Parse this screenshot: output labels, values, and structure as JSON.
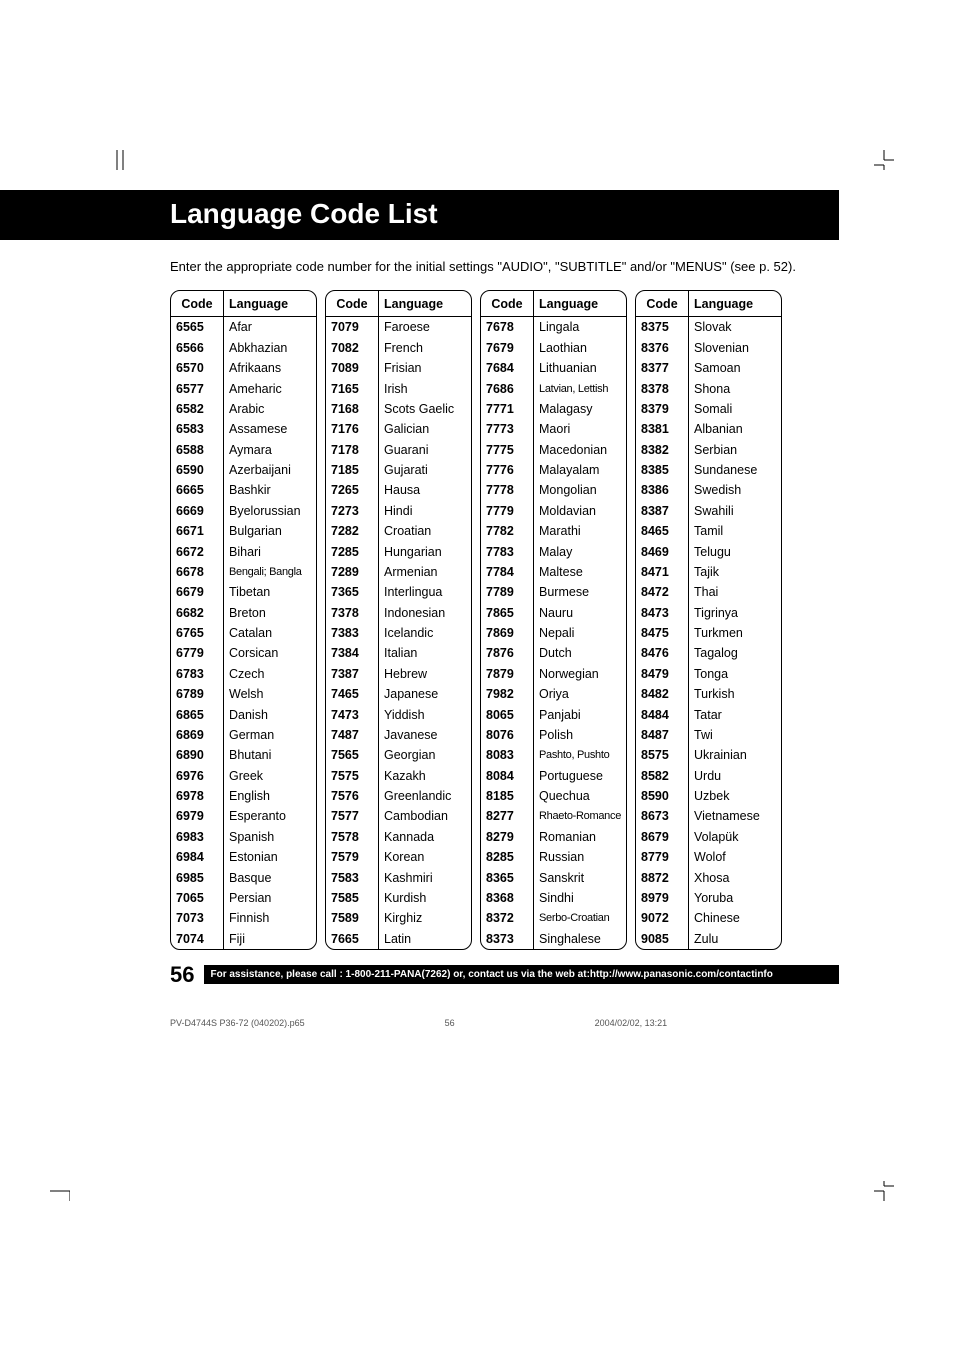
{
  "title": "Language Code List",
  "intro": "Enter the appropriate code number for the initial settings \"AUDIO\", \"SUBTITLE\" and/or \"MENUS\" (see p. 52).",
  "header_code": "Code",
  "header_language": "Language",
  "page_number": "56",
  "assist_text": "For assistance, please call : 1-800-211-PANA(7262) or, contact us via the web at:http://www.panasonic.com/contactinfo",
  "print_file": "PV-D4744S P36-72 (040202).p65",
  "print_page": "56",
  "print_date": "2004/02/02, 13:21",
  "columns": [
    [
      {
        "code": "6565",
        "lang": "Afar"
      },
      {
        "code": "6566",
        "lang": "Abkhazian"
      },
      {
        "code": "6570",
        "lang": "Afrikaans"
      },
      {
        "code": "6577",
        "lang": "Ameharic"
      },
      {
        "code": "6582",
        "lang": "Arabic"
      },
      {
        "code": "6583",
        "lang": "Assamese"
      },
      {
        "code": "6588",
        "lang": "Aymara"
      },
      {
        "code": "6590",
        "lang": "Azerbaijani"
      },
      {
        "code": "6665",
        "lang": "Bashkir"
      },
      {
        "code": "6669",
        "lang": "Byelorussian"
      },
      {
        "code": "6671",
        "lang": "Bulgarian"
      },
      {
        "code": "6672",
        "lang": "Bihari"
      },
      {
        "code": "6678",
        "lang": "Bengali; Bangla",
        "small": true
      },
      {
        "code": "6679",
        "lang": "Tibetan"
      },
      {
        "code": "6682",
        "lang": "Breton"
      },
      {
        "code": "6765",
        "lang": "Catalan"
      },
      {
        "code": "6779",
        "lang": "Corsican"
      },
      {
        "code": "6783",
        "lang": "Czech"
      },
      {
        "code": "6789",
        "lang": "Welsh"
      },
      {
        "code": "6865",
        "lang": "Danish"
      },
      {
        "code": "6869",
        "lang": "German"
      },
      {
        "code": "6890",
        "lang": "Bhutani"
      },
      {
        "code": "6976",
        "lang": "Greek"
      },
      {
        "code": "6978",
        "lang": "English"
      },
      {
        "code": "6979",
        "lang": "Esperanto"
      },
      {
        "code": "6983",
        "lang": "Spanish"
      },
      {
        "code": "6984",
        "lang": "Estonian"
      },
      {
        "code": "6985",
        "lang": "Basque"
      },
      {
        "code": "7065",
        "lang": "Persian"
      },
      {
        "code": "7073",
        "lang": "Finnish"
      },
      {
        "code": "7074",
        "lang": "Fiji"
      }
    ],
    [
      {
        "code": "7079",
        "lang": "Faroese"
      },
      {
        "code": "7082",
        "lang": "French"
      },
      {
        "code": "7089",
        "lang": "Frisian"
      },
      {
        "code": "7165",
        "lang": "Irish"
      },
      {
        "code": "7168",
        "lang": "Scots Gaelic"
      },
      {
        "code": "7176",
        "lang": "Galician"
      },
      {
        "code": "7178",
        "lang": "Guarani"
      },
      {
        "code": "7185",
        "lang": "Gujarati"
      },
      {
        "code": "7265",
        "lang": "Hausa"
      },
      {
        "code": "7273",
        "lang": "Hindi"
      },
      {
        "code": "7282",
        "lang": "Croatian"
      },
      {
        "code": "7285",
        "lang": "Hungarian"
      },
      {
        "code": "7289",
        "lang": "Armenian"
      },
      {
        "code": "7365",
        "lang": "Interlingua"
      },
      {
        "code": "7378",
        "lang": "Indonesian"
      },
      {
        "code": "7383",
        "lang": "Icelandic"
      },
      {
        "code": "7384",
        "lang": "Italian"
      },
      {
        "code": "7387",
        "lang": "Hebrew"
      },
      {
        "code": "7465",
        "lang": "Japanese"
      },
      {
        "code": "7473",
        "lang": "Yiddish"
      },
      {
        "code": "7487",
        "lang": "Javanese"
      },
      {
        "code": "7565",
        "lang": "Georgian"
      },
      {
        "code": "7575",
        "lang": "Kazakh"
      },
      {
        "code": "7576",
        "lang": "Greenlandic"
      },
      {
        "code": "7577",
        "lang": "Cambodian"
      },
      {
        "code": "7578",
        "lang": "Kannada"
      },
      {
        "code": "7579",
        "lang": "Korean"
      },
      {
        "code": "7583",
        "lang": "Kashmiri"
      },
      {
        "code": "7585",
        "lang": "Kurdish"
      },
      {
        "code": "7589",
        "lang": "Kirghiz"
      },
      {
        "code": "7665",
        "lang": "Latin"
      }
    ],
    [
      {
        "code": "7678",
        "lang": "Lingala"
      },
      {
        "code": "7679",
        "lang": "Laothian"
      },
      {
        "code": "7684",
        "lang": "Lithuanian"
      },
      {
        "code": "7686",
        "lang": "Latvian, Lettish",
        "small": true
      },
      {
        "code": "7771",
        "lang": "Malagasy"
      },
      {
        "code": "7773",
        "lang": "Maori"
      },
      {
        "code": "7775",
        "lang": "Macedonian"
      },
      {
        "code": "7776",
        "lang": "Malayalam"
      },
      {
        "code": "7778",
        "lang": "Mongolian"
      },
      {
        "code": "7779",
        "lang": "Moldavian"
      },
      {
        "code": "7782",
        "lang": "Marathi"
      },
      {
        "code": "7783",
        "lang": "Malay"
      },
      {
        "code": "7784",
        "lang": "Maltese"
      },
      {
        "code": "7789",
        "lang": "Burmese"
      },
      {
        "code": "7865",
        "lang": "Nauru"
      },
      {
        "code": "7869",
        "lang": "Nepali"
      },
      {
        "code": "7876",
        "lang": "Dutch"
      },
      {
        "code": "7879",
        "lang": "Norwegian"
      },
      {
        "code": "7982",
        "lang": "Oriya"
      },
      {
        "code": "8065",
        "lang": "Panjabi"
      },
      {
        "code": "8076",
        "lang": "Polish"
      },
      {
        "code": "8083",
        "lang": "Pashto, Pushto",
        "small": true
      },
      {
        "code": "8084",
        "lang": "Portuguese"
      },
      {
        "code": "8185",
        "lang": "Quechua"
      },
      {
        "code": "8277",
        "lang": "Rhaeto-Romance",
        "small": true
      },
      {
        "code": "8279",
        "lang": "Romanian"
      },
      {
        "code": "8285",
        "lang": "Russian"
      },
      {
        "code": "8365",
        "lang": "Sanskrit"
      },
      {
        "code": "8368",
        "lang": "Sindhi"
      },
      {
        "code": "8372",
        "lang": "Serbo-Croatian",
        "small": true
      },
      {
        "code": "8373",
        "lang": "Singhalese"
      }
    ],
    [
      {
        "code": "8375",
        "lang": "Slovak"
      },
      {
        "code": "8376",
        "lang": "Slovenian"
      },
      {
        "code": "8377",
        "lang": "Samoan"
      },
      {
        "code": "8378",
        "lang": "Shona"
      },
      {
        "code": "8379",
        "lang": "Somali"
      },
      {
        "code": "8381",
        "lang": "Albanian"
      },
      {
        "code": "8382",
        "lang": "Serbian"
      },
      {
        "code": "8385",
        "lang": "Sundanese"
      },
      {
        "code": "8386",
        "lang": "Swedish"
      },
      {
        "code": "8387",
        "lang": "Swahili"
      },
      {
        "code": "8465",
        "lang": "Tamil"
      },
      {
        "code": "8469",
        "lang": "Telugu"
      },
      {
        "code": "8471",
        "lang": "Tajik"
      },
      {
        "code": "8472",
        "lang": "Thai"
      },
      {
        "code": "8473",
        "lang": "Tigrinya"
      },
      {
        "code": "8475",
        "lang": "Turkmen"
      },
      {
        "code": "8476",
        "lang": "Tagalog"
      },
      {
        "code": "8479",
        "lang": "Tonga"
      },
      {
        "code": "8482",
        "lang": "Turkish"
      },
      {
        "code": "8484",
        "lang": "Tatar"
      },
      {
        "code": "8487",
        "lang": "Twi"
      },
      {
        "code": "8575",
        "lang": "Ukrainian"
      },
      {
        "code": "8582",
        "lang": "Urdu"
      },
      {
        "code": "8590",
        "lang": "Uzbek"
      },
      {
        "code": "8673",
        "lang": "Vietnamese"
      },
      {
        "code": "8679",
        "lang": "Volapük"
      },
      {
        "code": "8779",
        "lang": "Wolof"
      },
      {
        "code": "8872",
        "lang": "Xhosa"
      },
      {
        "code": "8979",
        "lang": "Yoruba"
      },
      {
        "code": "9072",
        "lang": "Chinese"
      },
      {
        "code": "9085",
        "lang": "Zulu"
      }
    ]
  ]
}
